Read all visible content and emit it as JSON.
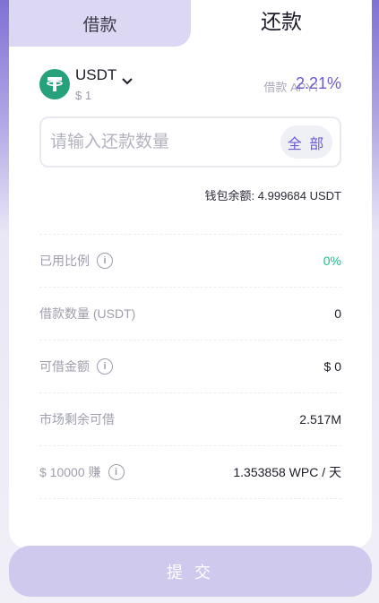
{
  "tabs": {
    "borrow": "借款",
    "repay": "还款",
    "active": "repay"
  },
  "token": {
    "symbol": "USDT",
    "price": "$ 1",
    "logo_icon": "tether-icon",
    "brand_color": "#26a17b"
  },
  "apy": {
    "label": "借款 APY：",
    "value": "2.21%"
  },
  "amount_input": {
    "placeholder": "请输入还款数量",
    "value": ""
  },
  "max_button": "全 部",
  "wallet": {
    "label": "钱包余额:",
    "value": "4.999684 USDT"
  },
  "stats": [
    {
      "label": "已用比例",
      "value": "0%",
      "info": true,
      "value_color": "#1dbe8a"
    },
    {
      "label": "借款数量 (USDT)",
      "value": "0",
      "info": false
    },
    {
      "label": "可借金额",
      "value": "$ 0",
      "info": true
    },
    {
      "label": "市场剩余可借",
      "value": "2.517M",
      "info": false
    },
    {
      "label": "$ 10000 赚",
      "value": "1.353858 WPC / 天",
      "info": true
    }
  ],
  "submit_label": "提 交",
  "colors": {
    "accent": "#6b5bd2",
    "positive": "#1dbe8a",
    "submit_disabled": "#cfc9ee"
  }
}
